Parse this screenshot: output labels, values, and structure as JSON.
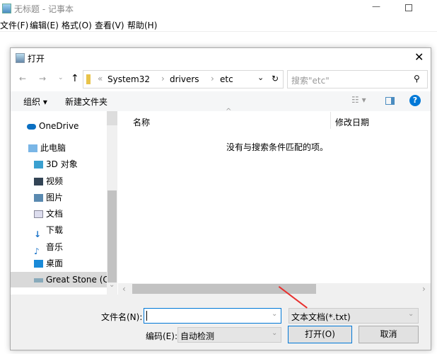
{
  "notepad": {
    "title": "无标题 - 记事本",
    "menu": [
      "文件(F)",
      "编辑(E)",
      "格式(O)",
      "查看(V)",
      "帮助(H)"
    ]
  },
  "dialog": {
    "title": "打开",
    "breadcrumb": [
      "System32",
      "drivers",
      "etc"
    ],
    "search_placeholder": "搜索\"etc\"",
    "toolbar": {
      "organize": "组织",
      "new_folder": "新建文件夹"
    },
    "nav": {
      "onedrive": "OneDrive",
      "this_pc": "此电脑",
      "items": [
        "3D 对象",
        "视频",
        "图片",
        "文档",
        "下载",
        "音乐",
        "桌面",
        "Great Stone (C:)"
      ]
    },
    "columns": {
      "name": "名称",
      "modified": "修改日期"
    },
    "empty_message": "没有与搜索条件匹配的项。",
    "filename_label": "文件名(N):",
    "filename_value": "",
    "filetype": "文本文档(*.txt)",
    "encoding_label": "编码(E):",
    "encoding": "自动检测",
    "open_button": "打开(O)",
    "cancel_button": "取消"
  },
  "colors": {
    "accent": "#0078d7",
    "arrow": "#e8312f"
  }
}
